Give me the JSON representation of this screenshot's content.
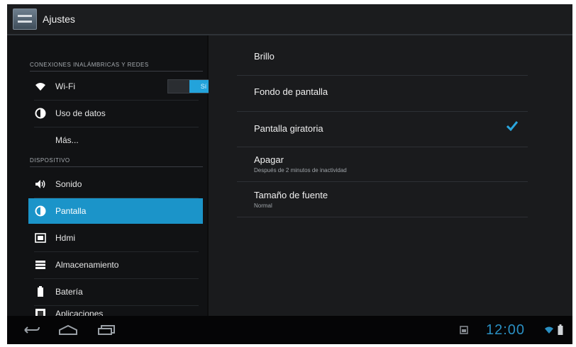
{
  "action_bar": {
    "title": "Ajustes",
    "icon": "settings-icon"
  },
  "sidebar": {
    "sections": [
      {
        "header": "CONEXIONES INALÁMBRICAS Y REDES"
      },
      {
        "header": "DISPOSITIVO"
      }
    ],
    "items": [
      {
        "label": "Wi-Fi",
        "icon": "wifi-icon",
        "toggle": "Sí"
      },
      {
        "label": "Uso de datos",
        "icon": "data-usage-icon"
      },
      {
        "label": "Más..."
      },
      {
        "label": "Sonido",
        "icon": "volume-icon"
      },
      {
        "label": "Pantalla",
        "icon": "display-icon",
        "selected": true
      },
      {
        "label": "Hdmi",
        "icon": "hdmi-icon"
      },
      {
        "label": "Almacenamiento",
        "icon": "storage-icon"
      },
      {
        "label": "Batería",
        "icon": "battery-icon"
      },
      {
        "label": "Aplicaciones",
        "icon": "apps-icon"
      }
    ]
  },
  "display_settings": {
    "items": [
      {
        "title": "Brillo"
      },
      {
        "title": "Fondo de pantalla"
      },
      {
        "title": "Pantalla giratoria",
        "checked": true
      },
      {
        "title": "Apagar",
        "summary": "Después de 2 minutos de inactividad"
      },
      {
        "title": "Tamaño de fuente",
        "summary": "Normal"
      }
    ]
  },
  "status_bar": {
    "time": "12:00"
  },
  "colors": {
    "accent": "#1b94c9",
    "clock": "#2a8fc2",
    "background": "#111214"
  }
}
